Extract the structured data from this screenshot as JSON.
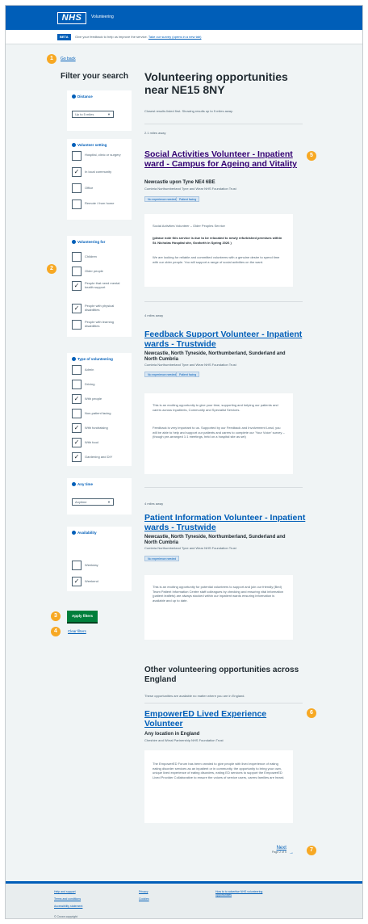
{
  "header": {
    "logo": "NHS",
    "service_name": "Volunteering"
  },
  "phase_banner": {
    "tag": "BETA",
    "text": "Give your feedback to help us improve the service.",
    "link": "Take our survey (opens in a new tab)"
  },
  "back_link": "Go back",
  "markers": [
    "1",
    "2",
    "3",
    "4",
    "5",
    "6",
    "7"
  ],
  "sidebar": {
    "title": "Filter your search",
    "distance": {
      "heading": "Distance",
      "value": "Up to 5 miles"
    },
    "volunteer_setting": {
      "heading": "Volunteer setting",
      "options": [
        {
          "label": "Hospital, clinic or surgery",
          "checked": false
        },
        {
          "label": "In local community",
          "checked": true
        },
        {
          "label": "Office",
          "checked": false
        },
        {
          "label": "Remote / from home",
          "checked": false
        }
      ]
    },
    "volunteering_for": {
      "heading": "Volunteering for",
      "options": [
        {
          "label": "Children",
          "checked": false
        },
        {
          "label": "Older people",
          "checked": false
        },
        {
          "label": "People that need mental health support",
          "checked": true
        },
        {
          "label": "People with physical disabilities",
          "checked": true
        },
        {
          "label": "People with learning disabilities",
          "checked": false
        }
      ]
    },
    "type_of_volunteering": {
      "heading": "Type of volunteering",
      "options": [
        {
          "label": "Admin",
          "checked": false
        },
        {
          "label": "Driving",
          "checked": false
        },
        {
          "label": "With people",
          "checked": true
        },
        {
          "label": "Non-patient facing",
          "checked": false
        },
        {
          "label": "With fundraising",
          "checked": true
        },
        {
          "label": "With food",
          "checked": true
        },
        {
          "label": "Gardening and DIY",
          "checked": true
        }
      ]
    },
    "any_time": {
      "heading": "Any time",
      "value": "Anytime"
    },
    "availability": {
      "heading": "Availability",
      "options": [
        {
          "label": "Weekday",
          "checked": false
        },
        {
          "label": "Weekend",
          "checked": true
        }
      ]
    },
    "apply_label": "Apply filters",
    "clear_label": "Clear filters"
  },
  "main": {
    "title": "Volunteering opportunities near NE15 8NY",
    "intro": "Closest results listed first. Showing results up to 5 miles away.",
    "results": [
      {
        "distance": "2.1 miles away",
        "title": "Social Activities Volunteer - Inpatient ward - Campus for Ageing and Vitality",
        "location": "Newcastle upon Tyne NE4 6BE",
        "organisation": "Cumbria Northumberland Tyne and Wear NHS Foundation Trust",
        "tags": [
          "No experience needed",
          "Patient facing"
        ],
        "description": [
          "Social Activities Volunteer – Older Peoples Service",
          "(please note this service is due to be relocated to newly refurbished premises within St. Nicholas Hospital site, Gosforth in Spring 2026 )",
          "We are looking for reliable and committed volunteers with a genuine desire to spend time with our older people. You will support a range of social activities on the ward."
        ]
      },
      {
        "distance": "4 miles away",
        "title": "Feedback Support Volunteer - Inpatient wards - Trustwide",
        "location": "Newcastle, North Tyneside, Northumberland, Sunderland and North Cumbria",
        "organisation": "Cumbria Northumberland Tyne and Wear NHS Foundation Trust",
        "tags": [
          "No experience needed",
          "Patient facing"
        ],
        "description": [
          "This is an exciting opportunity to give your time, supporting and helping our patients and carers across Inpatients, Community and Specialist Services.",
          "Feedback is very important to us. Supported by our Feedback and Involvement Lead, you will be able to help and support our patients and carers to complete our 'Your Voice' survey – (though pre-arranged 1:1 meetings, held on a hospital site as set)"
        ]
      },
      {
        "distance": "4 miles away",
        "title": "Patient Information Volunteer - Inpatient wards - Trustwide",
        "location": "Newcastle, North Tyneside, Northumberland, Sunderland and North Cumbria",
        "organisation": "Cumbria Northumberland Tyne and Wear NHS Foundation Trust",
        "tags": [
          "No experience needed"
        ],
        "description": [
          "This is an exciting opportunity for potential volunteers to support and join our friendly (Bed) Team Patient Information Centre staff colleagues by checking and ensuring vital information (patient leaflets) are always stocked within our inpatient wards ensuring information is available and up to date."
        ]
      }
    ],
    "other_section": {
      "title": "Other volunteering opportunities across England",
      "text": "These opportunities are available no matter where you are in England.",
      "result": {
        "title": "EmpowerED Lived Experience Volunteer",
        "location": "Any location in England",
        "organisation": "Cheshire and Wirral Partnership NHS Foundation Trust",
        "description": "The EmpowerED Forum has been created to give people with lived experience of eating eating disorder services as an inpatient or in community, the opportunity to bring your own, unique lived experience of eating disorders, eating ED services to support the EmpowerED Lived Provider Collaborative to ensure the voices of service users, carers families are heard."
      }
    },
    "pagination": {
      "next_label": "Next",
      "next_sub": "Page 2 of 5"
    }
  },
  "footer": {
    "col1": [
      "Help and support",
      "Terms and conditions",
      "Accessibility statement"
    ],
    "col2": [
      "Privacy",
      "Cookies"
    ],
    "col3": [
      "How to to advertise NHS volunteering opportunities"
    ],
    "copyright": "© Crown copyright"
  },
  "colors": {
    "nhs_blue": "#005eb8",
    "button_green": "#007f3b",
    "marker_orange": "#f7a823",
    "visited_purple": "#330072"
  }
}
